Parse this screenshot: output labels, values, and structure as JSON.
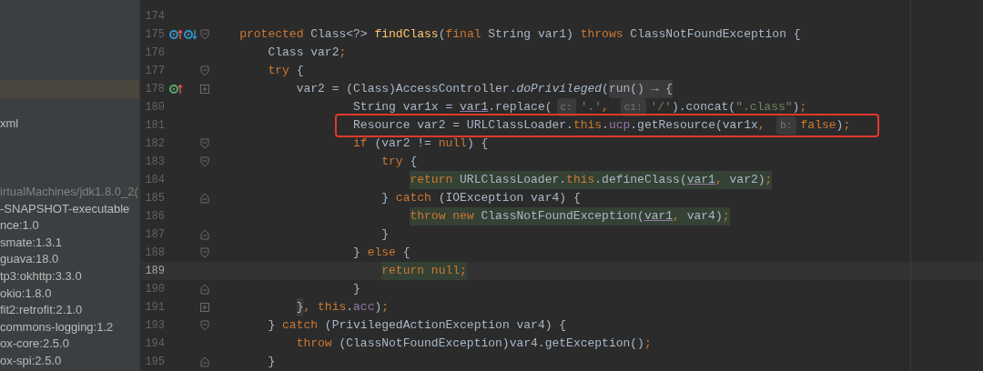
{
  "sidebar": {
    "highlighted_row": {
      "selected": true
    },
    "file_label": "xml",
    "items": [
      {
        "label": "irtualMachines/jdk1.8.0_2(",
        "dimmed": true
      },
      {
        "label": "-SNAPSHOT-executable",
        "dimmed": false
      },
      {
        "label": "nce:1.0",
        "dimmed": false
      },
      {
        "label": "smate:1.3.1",
        "dimmed": false
      },
      {
        "label": "guava:18.0",
        "dimmed": false
      },
      {
        "label": "tp3:okhttp:3.3.0",
        "dimmed": false
      },
      {
        "label": "okio:1.8.0",
        "dimmed": false
      },
      {
        "label": "fit2:retrofit:2.1.0",
        "dimmed": false
      },
      {
        "label": "commons-logging:1.2",
        "dimmed": false
      },
      {
        "label": "ox-core:2.5.0",
        "dimmed": false
      },
      {
        "label": "ox-spi:2.5.0",
        "dimmed": false
      }
    ]
  },
  "editor": {
    "lines": [
      {
        "number": "174"
      },
      {
        "number": "175",
        "markers": [
          {
            "kind": "override-up"
          },
          {
            "kind": "overridden-down"
          }
        ],
        "fold": {
          "kind": "start"
        },
        "tokens": [
          {
            "kind": "kw",
            "text": "    protected "
          },
          {
            "kind": "plain",
            "text": "Class<?> "
          },
          {
            "kind": "method",
            "text": "findClass"
          },
          {
            "kind": "plain",
            "text": "("
          },
          {
            "kind": "kw",
            "text": "final "
          },
          {
            "kind": "plain",
            "text": "String var1) "
          },
          {
            "kind": "kw",
            "text": "throws "
          },
          {
            "kind": "plain",
            "text": "ClassNotFoundException {"
          }
        ]
      },
      {
        "number": "176",
        "tokens": [
          {
            "kind": "plain",
            "text": "        Class var2"
          },
          {
            "kind": "kw",
            "text": ";"
          }
        ]
      },
      {
        "number": "177",
        "fold": {
          "kind": "start"
        },
        "tokens": [
          {
            "kind": "kw",
            "text": "        try "
          },
          {
            "kind": "plain",
            "text": "{"
          }
        ]
      },
      {
        "number": "178",
        "markers": [
          {
            "kind": "implements-up"
          }
        ],
        "fold": {
          "kind": "folded"
        },
        "tokens": [
          {
            "kind": "plain",
            "text": "            var2 = (Class)AccessController."
          },
          {
            "kind": "static",
            "text": "doPrivileged"
          },
          {
            "kind": "plain",
            "text": "("
          },
          {
            "kind": "folded",
            "text": "run() → {"
          }
        ]
      },
      {
        "number": "180",
        "tokens": [
          {
            "kind": "plain",
            "text": "                    String var1x = "
          },
          {
            "kind": "param",
            "text": "var1"
          },
          {
            "kind": "plain",
            "text": ".replace("
          },
          {
            "kind": "hint",
            "text": "c:"
          },
          {
            "kind": "str",
            "text": "'.'"
          },
          {
            "kind": "kw",
            "text": ", "
          },
          {
            "kind": "hint",
            "text": "c1:"
          },
          {
            "kind": "str",
            "text": "'/'"
          },
          {
            "kind": "plain",
            "text": ").concat("
          },
          {
            "kind": "str",
            "text": "\".class\""
          },
          {
            "kind": "plain",
            "text": ")"
          },
          {
            "kind": "kw",
            "text": ";"
          }
        ]
      },
      {
        "number": "181",
        "boxed": true,
        "tokens": [
          {
            "kind": "plain",
            "text": "                    Resource var2 = URLClassLoader."
          },
          {
            "kind": "kw",
            "text": "this"
          },
          {
            "kind": "plain",
            "text": "."
          },
          {
            "kind": "field",
            "text": "ucp"
          },
          {
            "kind": "plain",
            "text": ".getResource(var1x"
          },
          {
            "kind": "kw",
            "text": ", "
          },
          {
            "kind": "hint",
            "text": "b:"
          },
          {
            "kind": "kw",
            "text": "false"
          },
          {
            "kind": "plain",
            "text": ")"
          },
          {
            "kind": "kw",
            "text": ";"
          }
        ]
      },
      {
        "number": "182",
        "fold": {
          "kind": "start"
        },
        "tokens": [
          {
            "kind": "kw",
            "text": "                    if "
          },
          {
            "kind": "plain",
            "text": "(var2 != "
          },
          {
            "kind": "kw",
            "text": "null"
          },
          {
            "kind": "plain",
            "text": ") {"
          }
        ]
      },
      {
        "number": "183",
        "fold": {
          "kind": "start"
        },
        "tokens": [
          {
            "kind": "kw",
            "text": "                        try "
          },
          {
            "kind": "plain",
            "text": "{"
          }
        ]
      },
      {
        "number": "184",
        "highlighted": true,
        "tokens": [
          {
            "kind": "kw",
            "text": "                            return "
          },
          {
            "kind": "plain",
            "text": "URLClassLoader."
          },
          {
            "kind": "kw",
            "text": "this"
          },
          {
            "kind": "plain",
            "text": ".defineClass("
          },
          {
            "kind": "param",
            "text": "var1"
          },
          {
            "kind": "kw",
            "text": ", "
          },
          {
            "kind": "plain",
            "text": "var2)"
          },
          {
            "kind": "kw",
            "text": ";"
          }
        ]
      },
      {
        "number": "185",
        "fold": {
          "kind": "end"
        },
        "tokens": [
          {
            "kind": "plain",
            "text": "                        } "
          },
          {
            "kind": "kw",
            "text": "catch "
          },
          {
            "kind": "plain",
            "text": "(IOException var4) {"
          }
        ]
      },
      {
        "number": "186",
        "highlighted": true,
        "tokens": [
          {
            "kind": "kw",
            "text": "                            throw new "
          },
          {
            "kind": "plain",
            "text": "ClassNotFoundException("
          },
          {
            "kind": "param",
            "text": "var1"
          },
          {
            "kind": "kw",
            "text": ", "
          },
          {
            "kind": "plain",
            "text": "var4)"
          },
          {
            "kind": "kw",
            "text": ";"
          }
        ]
      },
      {
        "number": "187",
        "fold": {
          "kind": "end"
        },
        "tokens": [
          {
            "kind": "plain",
            "text": "                        }"
          }
        ]
      },
      {
        "number": "188",
        "fold": {
          "kind": "start"
        },
        "tokens": [
          {
            "kind": "plain",
            "text": "                    } "
          },
          {
            "kind": "kw",
            "text": "else "
          },
          {
            "kind": "plain",
            "text": "{"
          }
        ]
      },
      {
        "number": "189",
        "current": true,
        "highlighted": true,
        "tokens": [
          {
            "kind": "kw",
            "text": "                        return null;"
          }
        ]
      },
      {
        "number": "190",
        "fold": {
          "kind": "end"
        },
        "tokens": [
          {
            "kind": "plain",
            "text": "                    }"
          }
        ]
      },
      {
        "number": "191",
        "fold": {
          "kind": "folded"
        },
        "tokens": [
          {
            "kind": "folded",
            "text": "            }"
          },
          {
            "kind": "kw",
            "text": ", this"
          },
          {
            "kind": "plain",
            "text": "."
          },
          {
            "kind": "field",
            "text": "acc"
          },
          {
            "kind": "plain",
            "text": ")"
          },
          {
            "kind": "kw",
            "text": ";"
          }
        ]
      },
      {
        "number": "193",
        "fold": {
          "kind": "start"
        },
        "tokens": [
          {
            "kind": "plain",
            "text": "        } "
          },
          {
            "kind": "kw",
            "text": "catch "
          },
          {
            "kind": "plain",
            "text": "(PrivilegedActionException var4) {"
          }
        ]
      },
      {
        "number": "194",
        "tokens": [
          {
            "kind": "kw",
            "text": "            throw "
          },
          {
            "kind": "plain",
            "text": "(ClassNotFoundException)var4.getException()"
          },
          {
            "kind": "kw",
            "text": ";"
          }
        ]
      },
      {
        "number": "195",
        "fold": {
          "kind": "end"
        },
        "tokens": [
          {
            "kind": "plain",
            "text": "        }"
          }
        ]
      }
    ]
  }
}
